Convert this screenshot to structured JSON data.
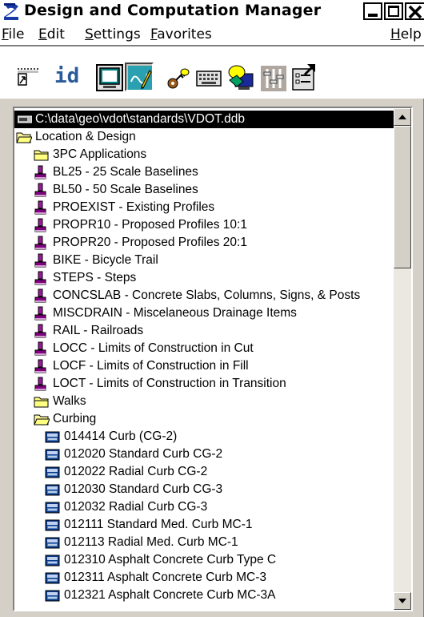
{
  "window": {
    "title": "Design and Computation Manager",
    "caption_buttons": [
      "minimize",
      "maximize",
      "close"
    ]
  },
  "menu": {
    "items": [
      {
        "label": "File",
        "underline": "F",
        "rest": "ile"
      },
      {
        "label": "Edit",
        "underline": "E",
        "rest": "dit"
      },
      {
        "label": "Settings",
        "underline": "S",
        "rest": "ettings"
      },
      {
        "label": "Favorites",
        "underline": "F",
        "rest": "avorites"
      }
    ],
    "help": {
      "label": "Help",
      "underline": "H",
      "rest": "elp"
    }
  },
  "toolbar": {
    "id_label": "id",
    "icons": [
      "pointer-icon",
      "id-icon",
      "display-icon",
      "draw-icon",
      "key-icon",
      "keyboard-icon",
      "query-icon",
      "filter-icon",
      "properties-icon"
    ]
  },
  "tree": {
    "root": "C:\\data\\geo\\vdot\\standards\\VDOT.ddb",
    "items": [
      {
        "label": "Location & Design",
        "icon": "folder-open-icon",
        "level": 0
      },
      {
        "label": "3PC Applications",
        "icon": "folder-icon",
        "level": 1
      },
      {
        "label": "BL25  - 25 Scale Baselines",
        "icon": "pen-icon",
        "level": 1
      },
      {
        "label": "BL50  - 50 Scale Baselines",
        "icon": "pen-icon",
        "level": 1
      },
      {
        "label": "PROEXIST  - Existing Profiles",
        "icon": "pen-icon",
        "level": 1
      },
      {
        "label": "PROPR10  - Proposed Profiles 10:1",
        "icon": "pen-icon",
        "level": 1
      },
      {
        "label": "PROPR20  - Proposed Profiles 20:1",
        "icon": "pen-icon",
        "level": 1
      },
      {
        "label": "BIKE  - Bicycle Trail",
        "icon": "pen-icon",
        "level": 1
      },
      {
        "label": "STEPS  - Steps",
        "icon": "pen-icon",
        "level": 1
      },
      {
        "label": "CONCSLAB  - Concrete Slabs, Columns, Signs, & Posts",
        "icon": "pen-icon",
        "level": 1
      },
      {
        "label": "MISCDRAIN  - Miscelaneous Drainage Items",
        "icon": "pen-icon",
        "level": 1
      },
      {
        "label": "RAIL  - Railroads",
        "icon": "pen-icon",
        "level": 1
      },
      {
        "label": "LOCC  - Limits of Construction in Cut",
        "icon": "pen-icon",
        "level": 1
      },
      {
        "label": "LOCF  - Limits of Construction in Fill",
        "icon": "pen-icon",
        "level": 1
      },
      {
        "label": "LOCT  - Limits of Construction in Transition",
        "icon": "pen-icon",
        "level": 1
      },
      {
        "label": "Walks",
        "icon": "folder-icon",
        "level": 1
      },
      {
        "label": "Curbing",
        "icon": "folder-open-icon",
        "level": 1
      },
      {
        "label": "014414 Curb (CG-2)",
        "icon": "cell-icon",
        "level": 2
      },
      {
        "label": "012020 Standard Curb CG-2",
        "icon": "cell-icon",
        "level": 2
      },
      {
        "label": "012022 Radial Curb CG-2",
        "icon": "cell-icon",
        "level": 2
      },
      {
        "label": "012030 Standard Curb CG-3",
        "icon": "cell-icon",
        "level": 2
      },
      {
        "label": "012032 Radial Curb CG-3",
        "icon": "cell-icon",
        "level": 2
      },
      {
        "label": "012111 Standard Med. Curb MC-1",
        "icon": "cell-icon",
        "level": 2
      },
      {
        "label": "012113 Radial Med. Curb MC-1",
        "icon": "cell-icon",
        "level": 2
      },
      {
        "label": "012310 Asphalt Concrete Curb Type C",
        "icon": "cell-icon",
        "level": 2
      },
      {
        "label": "012311 Asphalt Concrete Curb MC-3",
        "icon": "cell-icon",
        "level": 2
      },
      {
        "label": "012321 Asphalt Concrete Curb MC-3A",
        "icon": "cell-icon",
        "level": 2
      }
    ]
  },
  "colors": {
    "selection": "#000000",
    "folder": "#ffff80",
    "pen": "#800080",
    "cell": "#0a3a8a"
  }
}
